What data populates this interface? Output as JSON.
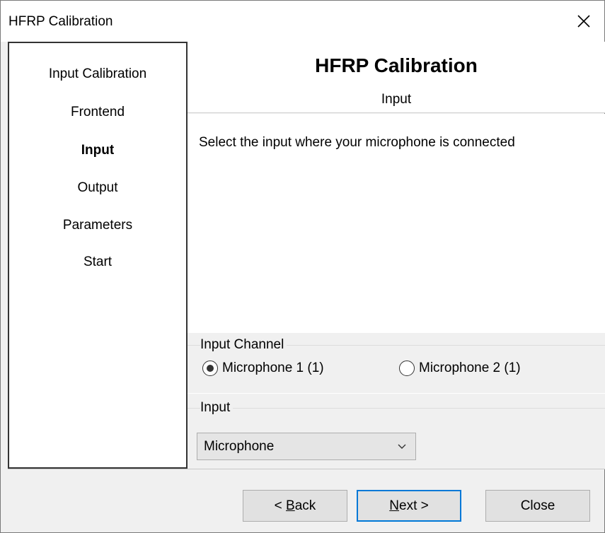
{
  "window": {
    "title": "HFRP Calibration"
  },
  "sidebar": {
    "items": [
      {
        "label": "Input Calibration",
        "active": false
      },
      {
        "label": "Frontend",
        "active": false
      },
      {
        "label": "Input",
        "active": true
      },
      {
        "label": "Output",
        "active": false
      },
      {
        "label": "Parameters",
        "active": false
      },
      {
        "label": "Start",
        "active": false
      }
    ]
  },
  "header": {
    "title": "HFRP Calibration",
    "subtitle": "Input"
  },
  "content": {
    "instruction": "Select the input where your microphone is connected",
    "input_channel": {
      "label": "Input Channel",
      "options": [
        {
          "label": "Microphone 1 (1)",
          "checked": true
        },
        {
          "label": "Microphone 2 (1)",
          "checked": false
        }
      ]
    },
    "input": {
      "label": "Input",
      "selected": "Microphone"
    }
  },
  "footer": {
    "back_mnemonic": "B",
    "back_rest": "ack",
    "back_prefix": "< ",
    "next_mnemonic": "N",
    "next_rest": "ext >",
    "close_label": "Close"
  },
  "icons": {
    "close": "close-icon",
    "dropdown": "chevron-down-icon"
  }
}
